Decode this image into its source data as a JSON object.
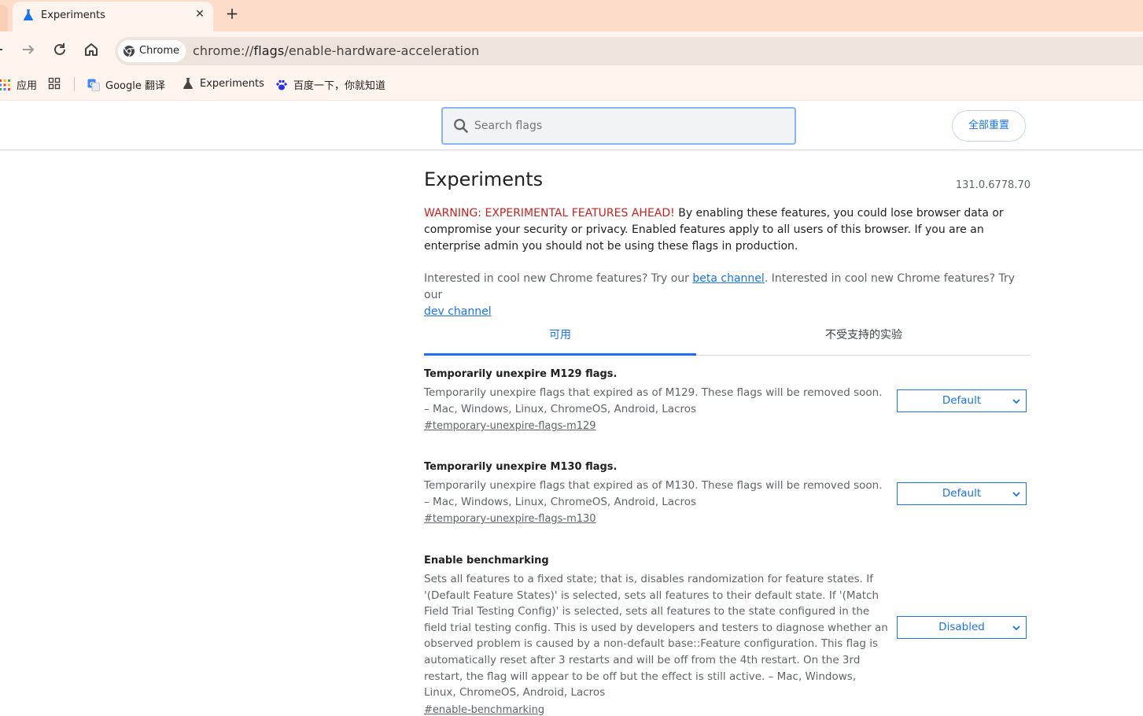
{
  "browser": {
    "tab_title": "Experiments",
    "new_tab_symbol": "+",
    "close_symbol": "✕",
    "omnibox_chip": "Chrome",
    "url_scheme": "chrome://",
    "url_host": "flags",
    "url_path": "/enable-hardware-acceleration"
  },
  "bookmarks": [
    {
      "label": "应用",
      "icon": "apps-grid-icon"
    },
    {
      "label": "",
      "icon": "tab-groups-icon"
    },
    {
      "label": "Google 翻译",
      "icon": "google-translate-icon"
    },
    {
      "label": "Experiments",
      "icon": "flask-icon"
    },
    {
      "label": "百度一下，你就知道",
      "icon": "baidu-paw-icon"
    }
  ],
  "search": {
    "placeholder": "Search flags"
  },
  "reset_all_label": "全部重置",
  "page": {
    "title": "Experiments",
    "version": "131.0.6778.70",
    "warning_label": "WARNING: EXPERIMENTAL FEATURES AHEAD!",
    "warning_text": " By enabling these features, you could lose browser data or compromise your security or privacy. Enabled features apply to all users of this browser. If you are an enterprise admin you should not be using these flags in production.",
    "interest_1": "Interested in cool new Chrome features? Try our ",
    "beta_link": "beta channel",
    "interest_2": ". Interested in cool new Chrome features? Try our ",
    "dev_link": "dev channel"
  },
  "tabs": [
    {
      "label": "可用",
      "active": true
    },
    {
      "label": "不受支持的实验",
      "active": false
    }
  ],
  "experiments": [
    {
      "name": "Temporarily unexpire M129 flags.",
      "description": "Temporarily unexpire flags that expired as of M129. These flags will be removed soon. – Mac, Windows, Linux, ChromeOS, Android, Lacros",
      "link": "#temporary-unexpire-flags-m129",
      "value": "Default"
    },
    {
      "name": "Temporarily unexpire M130 flags.",
      "description": "Temporarily unexpire flags that expired as of M130. These flags will be removed soon. – Mac, Windows, Linux, ChromeOS, Android, Lacros",
      "link": "#temporary-unexpire-flags-m130",
      "value": "Default"
    },
    {
      "name": "Enable benchmarking",
      "description": "Sets all features to a fixed state; that is, disables randomization for feature states. If '(Default Feature States)' is selected, sets all features to their default state. If '(Match Field Trial Testing Config)' is selected, sets all features to the state configured in the field trial testing config. This is used by developers and testers to diagnose whether an observed problem is caused by a non-default base::Feature configuration. This flag is automatically reset after 3 restarts and will be off from the 4th restart. On the 3rd restart, the flag will appear to be off but the effect is still active. – Mac, Windows, Linux, ChromeOS, Android, Lacros",
      "link": "#enable-benchmarking",
      "value": "Disabled"
    }
  ],
  "colors": {
    "accent": "#1a73e8",
    "warning": "#c5221f",
    "frame": "#fddcc9"
  }
}
